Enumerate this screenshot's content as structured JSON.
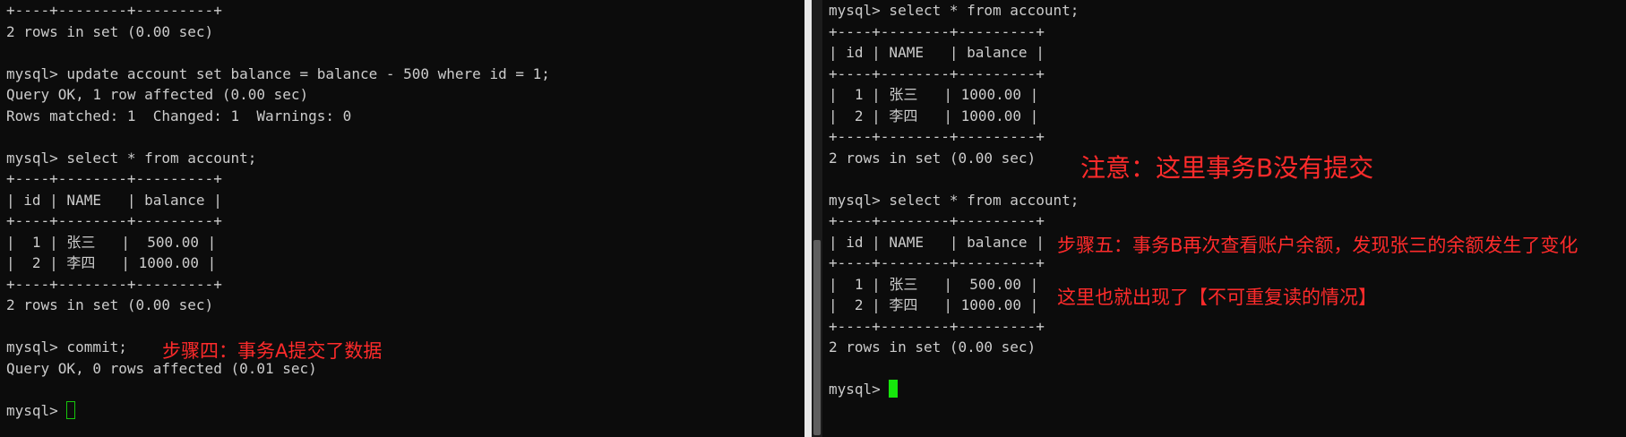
{
  "terminal_a": {
    "lines": [
      "+----+--------+---------+",
      "2 rows in set (0.00 sec)",
      "",
      "mysql> update account set balance = balance - 500 where id = 1;",
      "Query OK, 1 row affected (0.00 sec)",
      "Rows matched: 1  Changed: 1  Warnings: 0",
      "",
      "mysql> select * from account;",
      "+----+--------+---------+",
      "| id | NAME   | balance |",
      "+----+--------+---------+",
      "|  1 | 张三   |  500.00 |",
      "|  2 | 李四   | 1000.00 |",
      "+----+--------+---------+",
      "2 rows in set (0.00 sec)",
      "",
      "mysql> commit;",
      "Query OK, 0 rows affected (0.01 sec)",
      "",
      "mysql> "
    ]
  },
  "terminal_b": {
    "lines": [
      "mysql> select * from account;",
      "+----+--------+---------+",
      "| id | NAME   | balance |",
      "+----+--------+---------+",
      "|  1 | 张三   | 1000.00 |",
      "|  2 | 李四   | 1000.00 |",
      "+----+--------+---------+",
      "2 rows in set (0.00 sec)",
      "",
      "mysql> select * from account;",
      "+----+--------+---------+",
      "| id | NAME   | balance |",
      "+----+--------+---------+",
      "|  1 | 张三   |  500.00 |",
      "|  2 | 李四   | 1000.00 |",
      "+----+--------+---------+",
      "2 rows in set (0.00 sec)",
      "",
      "mysql> "
    ]
  },
  "annotations": {
    "step4": "步骤四：事务A提交了数据",
    "note": "注意：这里事务B没有提交",
    "step5": "步骤五：事务B再次查看账户余额，发现张三的余额发生了变化",
    "unrepeatable": "这里也就出现了【不可重复读的情况】"
  },
  "colors": {
    "terminal_bg": "#0c0c0c",
    "terminal_fg": "#cccccc",
    "annotation": "#ff2b2b",
    "cursor": "#16c60c"
  }
}
